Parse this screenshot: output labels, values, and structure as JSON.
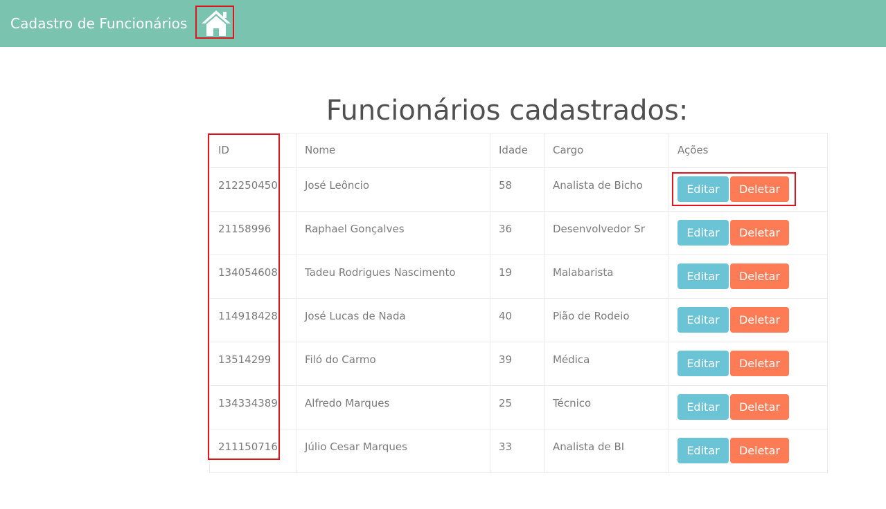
{
  "navbar": {
    "brand": "Cadastro de Funcionários",
    "home_icon": "home-icon",
    "background": "#7ac3ae"
  },
  "page": {
    "title": "Funcionários cadastrados:"
  },
  "table": {
    "headers": [
      "ID",
      "Nome",
      "Idade",
      "Cargo",
      "Ações"
    ],
    "rows": [
      {
        "id": "212250450",
        "nome": "José Leôncio",
        "idade": "58",
        "cargo": "Analista de Bicho"
      },
      {
        "id": "21158996",
        "nome": "Raphael Gonçalves",
        "idade": "36",
        "cargo": "Desenvolvedor Sr"
      },
      {
        "id": "134054608",
        "nome": "Tadeu Rodrigues Nascimento",
        "idade": "19",
        "cargo": "Malabarista"
      },
      {
        "id": "114918428",
        "nome": "José Lucas de Nada",
        "idade": "40",
        "cargo": "Pião de Rodeio"
      },
      {
        "id": "13514299",
        "nome": "Filó do Carmo",
        "idade": "39",
        "cargo": "Médica"
      },
      {
        "id": "134334389",
        "nome": "Alfredo Marques",
        "idade": "25",
        "cargo": "Técnico"
      },
      {
        "id": "211150716",
        "nome": "Júlio Cesar Marques",
        "idade": "33",
        "cargo": "Analista de BI"
      }
    ],
    "edit_label": "Editar",
    "delete_label": "Deletar"
  },
  "colors": {
    "edit_button": "#6bc3d6",
    "delete_button": "#fd7b55",
    "highlight": "#e0141e"
  }
}
